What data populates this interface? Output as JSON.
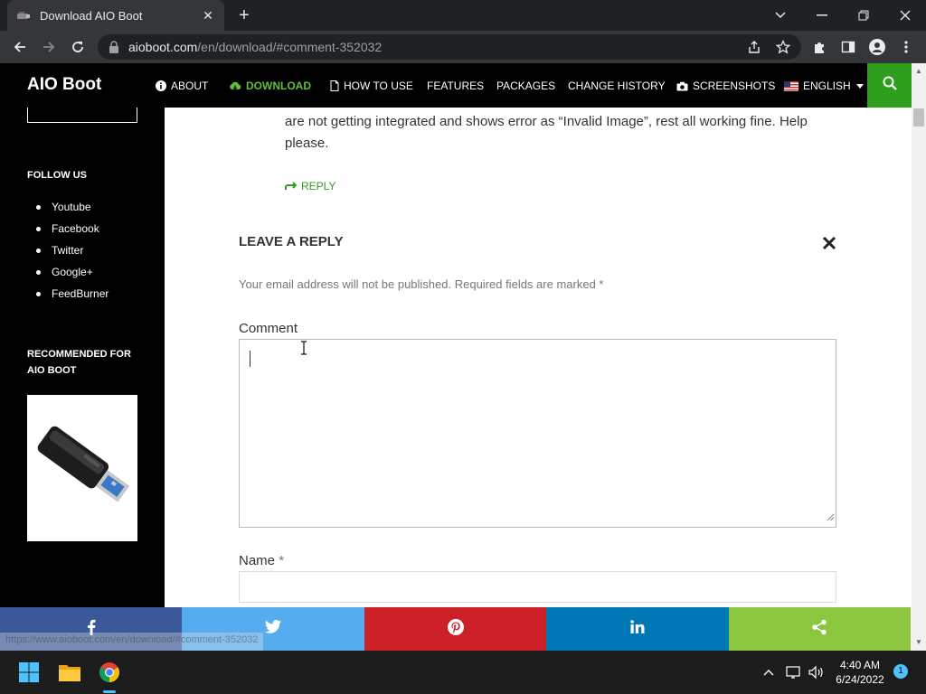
{
  "browser": {
    "tab_title": "Download AIO Boot",
    "url_host": "aioboot.com",
    "url_path": "/en/download/#comment-352032",
    "status_url": "https://www.aioboot.com/en/download/#comment-352032"
  },
  "site": {
    "logo": "AIO Boot",
    "nav": [
      {
        "label": "ABOUT",
        "icon": "info-icon"
      },
      {
        "label": "DOWNLOAD",
        "icon": "cloud-download-icon",
        "active": true
      },
      {
        "label": "HOW TO USE",
        "icon": "document-icon"
      },
      {
        "label": "FEATURES"
      },
      {
        "label": "PACKAGES"
      },
      {
        "label": "CHANGE HISTORY"
      },
      {
        "label": "SCREENSHOTS",
        "icon": "camera-icon"
      },
      {
        "label": "ENGLISH",
        "icon": "us-flag-icon"
      }
    ]
  },
  "sidebar": {
    "follow_heading": "FOLLOW US",
    "links": [
      "Youtube",
      "Facebook",
      "Twitter",
      "Google+",
      "FeedBurner"
    ],
    "recommended_heading": "RECOMMENDED FOR AIO BOOT"
  },
  "comment": {
    "text": "are not getting integrated and shows error as “Invalid Image”, rest all working fine. Help please.",
    "reply_label": "REPLY"
  },
  "reply_form": {
    "title": "LEAVE A REPLY",
    "notice": "Your email address will not be published. Required fields are marked *",
    "comment_label": "Comment",
    "comment_value": "",
    "name_label": "Name",
    "required_mark": "*",
    "name_value": ""
  },
  "share": [
    {
      "icon": "facebook-icon",
      "color": "#3b5998"
    },
    {
      "icon": "twitter-icon",
      "color": "#55acee"
    },
    {
      "icon": "pinterest-icon",
      "color": "#cb2027"
    },
    {
      "icon": "linkedin-icon",
      "color": "#0077b5"
    },
    {
      "icon": "share-icon",
      "color": "#8cc63f"
    }
  ],
  "taskbar": {
    "time": "4:40 AM",
    "date": "6/24/2022",
    "notifications": "1"
  },
  "colors": {
    "accent": "#2f9e1f",
    "nav_bg": "#000000"
  }
}
